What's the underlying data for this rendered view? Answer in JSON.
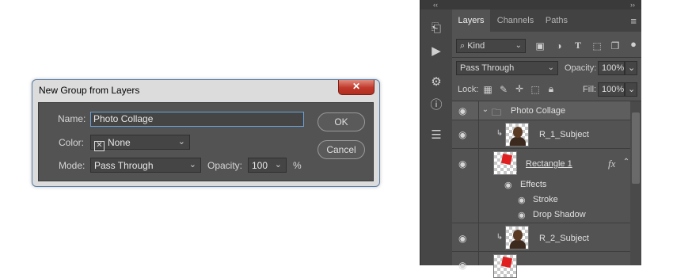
{
  "dialog": {
    "title": "New Group from Layers",
    "close_glyph": "✕",
    "name_label": "Name:",
    "name_value": "Photo Collage",
    "color_label": "Color:",
    "color_value": "None",
    "color_box_glyph": "✕",
    "mode_label": "Mode:",
    "mode_value": "Pass Through",
    "opacity_label": "Opacity:",
    "opacity_value": "100",
    "opacity_unit": "%",
    "ok_label": "OK",
    "cancel_label": "Cancel",
    "chevron_glyph": "⌄"
  },
  "toolstrip": {
    "collapse_glyph": "‹‹",
    "icons": [
      {
        "name": "history-icon",
        "glyph": "⎗"
      },
      {
        "name": "play-actions-icon",
        "glyph": "▶"
      },
      {
        "name": "properties-icon",
        "glyph": "⚙"
      },
      {
        "name": "info-icon",
        "glyph": "ⓘ"
      },
      {
        "name": "character-styles-icon",
        "glyph": "☰"
      }
    ]
  },
  "panel": {
    "expand_glyph": "››",
    "tabs": [
      {
        "label": "Layers",
        "active": true
      },
      {
        "label": "Channels",
        "active": false
      },
      {
        "label": "Paths",
        "active": false
      }
    ],
    "menu_glyph": "≡",
    "filter": {
      "kind_label": "Kind",
      "icons": [
        "image-filter-icon",
        "adjustment-filter-icon",
        "type-filter-icon",
        "shape-filter-icon",
        "smart-object-filter-icon",
        "filter-toggle-icon"
      ]
    },
    "blend_mode": "Pass Through",
    "opacity_label": "Opacity:",
    "opacity_value": "100%",
    "lock_label": "Lock:",
    "fill_label": "Fill:",
    "fill_value": "100%",
    "layers": [
      {
        "name": "Photo Collage",
        "type": "group"
      },
      {
        "name": "R_1_Subject",
        "type": "image"
      },
      {
        "name": "Rectangle 1",
        "type": "shape",
        "fx": "fx"
      },
      {
        "name": "Effects",
        "type": "effects-header"
      },
      {
        "name": "Stroke",
        "type": "effect"
      },
      {
        "name": "Drop Shadow",
        "type": "effect"
      },
      {
        "name": "R_2_Subject",
        "type": "image"
      }
    ]
  }
}
